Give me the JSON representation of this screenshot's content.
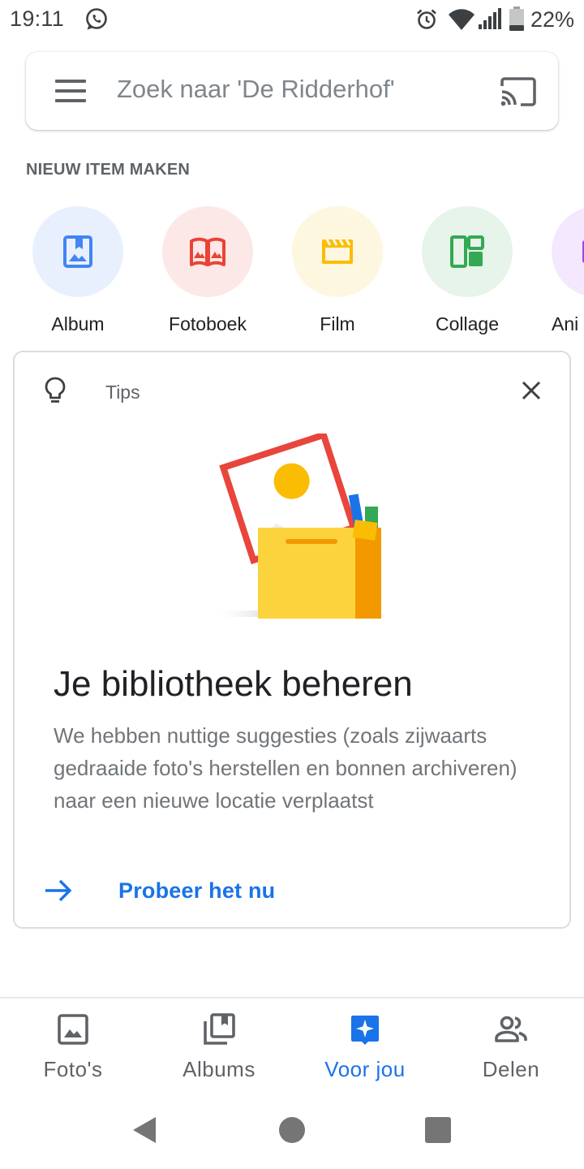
{
  "status_bar": {
    "time": "19:11",
    "battery_percent": "22%",
    "icons": [
      "whatsapp-icon",
      "alarm-icon",
      "wifi-icon",
      "signal-icon",
      "battery-icon"
    ]
  },
  "search": {
    "placeholder": "Zoek naar 'De Ridderhof'",
    "menu_icon": "menu-icon",
    "cast_icon": "cast-icon"
  },
  "create": {
    "section_title": "NIEUW ITEM MAKEN",
    "items": [
      {
        "label": "Album",
        "icon": "album-icon",
        "bg": "#e8f0fe",
        "color": "#4285f4"
      },
      {
        "label": "Fotoboek",
        "icon": "photobook-icon",
        "bg": "#fce8e6",
        "color": "#ea4335"
      },
      {
        "label": "Film",
        "icon": "film-icon",
        "bg": "#fef7e0",
        "color": "#fbbc04"
      },
      {
        "label": "Collage",
        "icon": "collage-icon",
        "bg": "#e6f4ea",
        "color": "#34a853"
      },
      {
        "label": "Ani",
        "icon": "animation-icon",
        "bg": "#f3e8fd",
        "color": "#a142f4"
      }
    ]
  },
  "tips": {
    "label": "Tips",
    "heading": "Je bibliotheek beheren",
    "body": "We hebben nuttige suggesties (zoals zijwaarts gedraaide foto's herstellen en bonnen archiveren) naar een nieuwe locatie verplaatst",
    "action_label": "Probeer het nu"
  },
  "bottom_nav": {
    "items": [
      {
        "label": "Foto's",
        "icon": "photos-icon",
        "active": false
      },
      {
        "label": "Albums",
        "icon": "albums-icon",
        "active": false
      },
      {
        "label": "Voor jou",
        "icon": "for-you-icon",
        "active": true
      },
      {
        "label": "Delen",
        "icon": "sharing-icon",
        "active": false
      }
    ]
  },
  "colors": {
    "accent": "#1a73e8",
    "text_secondary": "#5f6368",
    "text_primary": "#202124"
  }
}
